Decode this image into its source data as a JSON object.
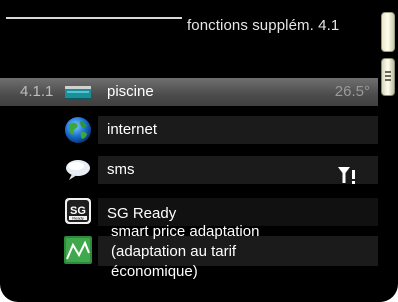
{
  "header": {
    "title": "fonctions supplém. 4.1"
  },
  "menu": {
    "items": [
      {
        "number": "4.1.1",
        "label": "piscine",
        "value": "26.5°",
        "icon": "pool-icon",
        "selected": true
      },
      {
        "number": "",
        "label": "internet",
        "value": "",
        "icon": "globe-icon",
        "selected": false
      },
      {
        "number": "",
        "label": "sms",
        "value": "",
        "icon": "speech-bubble-icon",
        "status_icon": "signal-warning-icon",
        "selected": false
      },
      {
        "number": "",
        "label": "SG Ready",
        "value": "",
        "icon": "sg-ready-icon",
        "icon_text_main": "SG",
        "icon_text_sub": "Ready",
        "selected": false
      },
      {
        "number": "",
        "label_lines": [
          "smart price adaptation",
          "(adaptation au tarif",
          "économique)"
        ],
        "value": "",
        "icon": "price-chart-icon",
        "selected": false
      }
    ]
  },
  "colors": {
    "background": "#000000",
    "selected_row": "#5a5a5a",
    "text": "#ffffff",
    "dim_text": "#9a9a9a"
  }
}
